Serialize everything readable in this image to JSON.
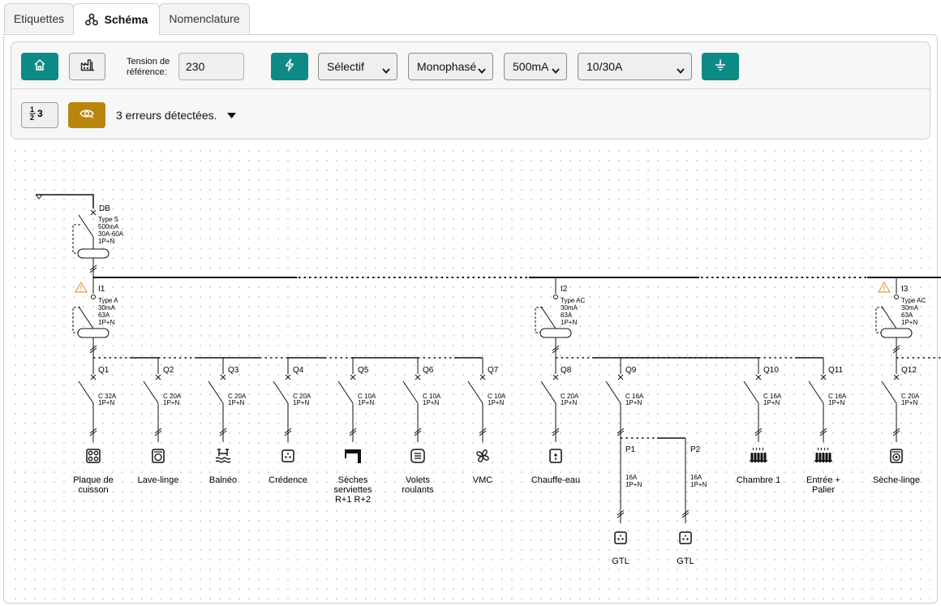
{
  "tabs": [
    {
      "label": "Etiquettes",
      "active": false
    },
    {
      "label": "Schéma",
      "active": true,
      "icon": "diagram-icon"
    },
    {
      "label": "Nomenclature",
      "active": false
    }
  ],
  "toolbar": {
    "home_icon": "home-icon",
    "factory_icon": "factory-icon",
    "tension_label_line1": "Tension de",
    "tension_label_line2": "référence:",
    "tension_value": "230",
    "lightning_icon": "lightning-icon",
    "selectivity": "Sélectif",
    "phase": "Monophasé",
    "main_sensitivity": "500mA",
    "secondary_sensitivity": "10/30A",
    "earth_icon": "earth-icon",
    "numbering_label": "1/2 3",
    "eye_icon": "eye-icon",
    "errors_text": "3 erreurs détectées.",
    "accent_color": "#0e8a86",
    "warning_color": "#b8860b"
  },
  "schema": {
    "main_breaker": {
      "id": "DB",
      "lines": [
        "Type S",
        "500mA",
        "30A-60A",
        "1P+N"
      ]
    },
    "rcds": [
      {
        "id": "I1",
        "lines": [
          "Type A",
          "30mA",
          "63A",
          "1P+N"
        ],
        "warning": true
      },
      {
        "id": "I2",
        "lines": [
          "Type AC",
          "30mA",
          "63A",
          "1P+N"
        ],
        "warning": false
      },
      {
        "id": "I3",
        "lines": [
          "Type AC",
          "30mA",
          "63A",
          "1P+N"
        ],
        "warning": true
      }
    ],
    "circuits": [
      {
        "id": "Q1",
        "rating": "C 32A",
        "poles": "1P+N",
        "label": [
          "Plaque de",
          "cuisson"
        ],
        "icon": "cooktop-icon"
      },
      {
        "id": "Q2",
        "rating": "C 20A",
        "poles": "1P+N",
        "label": [
          "Lave-linge"
        ],
        "icon": "washing-machine-icon"
      },
      {
        "id": "Q3",
        "rating": "C 20A",
        "poles": "1P+N",
        "label": [
          "Balnéo"
        ],
        "icon": "bathtub-icon"
      },
      {
        "id": "Q4",
        "rating": "C 20A",
        "poles": "1P+N",
        "label": [
          "Crédence"
        ],
        "icon": "outlet-icon"
      },
      {
        "id": "Q5",
        "rating": "C 10A",
        "poles": "1P+N",
        "label": [
          "Sèches",
          "serviettes",
          "R+1 R+2"
        ],
        "icon": "towel-dryer-icon"
      },
      {
        "id": "Q6",
        "rating": "C 10A",
        "poles": "1P+N",
        "label": [
          "Volets",
          "roulants"
        ],
        "icon": "shutter-icon"
      },
      {
        "id": "Q7",
        "rating": "C 10A",
        "poles": "1P+N",
        "label": [
          "VMC"
        ],
        "icon": "fan-icon"
      },
      {
        "id": "Q8",
        "rating": "C 20A",
        "poles": "1P+N",
        "label": [
          "Chauffe-eau"
        ],
        "icon": "water-heater-icon"
      },
      {
        "id": "Q9",
        "rating": "C 16A",
        "poles": "1P+N",
        "label": [],
        "icon": ""
      },
      {
        "id": "Q10",
        "rating": "C 16A",
        "poles": "1P+N",
        "label": [
          "Chambre 1"
        ],
        "icon": "radiator-icon"
      },
      {
        "id": "Q11",
        "rating": "C 16A",
        "poles": "1P+N",
        "label": [
          "Entrée +",
          "Palier"
        ],
        "icon": "radiator-icon"
      },
      {
        "id": "Q12",
        "rating": "C 20A",
        "poles": "1P+N",
        "label": [
          "Sèche-linge"
        ],
        "icon": "dryer-icon"
      }
    ],
    "sub_circuits": [
      {
        "id": "P1",
        "rating": "16A",
        "poles": "1P+N",
        "label": "GTL",
        "icon": "outlet-icon"
      },
      {
        "id": "P2",
        "rating": "16A",
        "poles": "1P+N",
        "label": "GTL",
        "icon": "outlet-icon"
      }
    ]
  }
}
